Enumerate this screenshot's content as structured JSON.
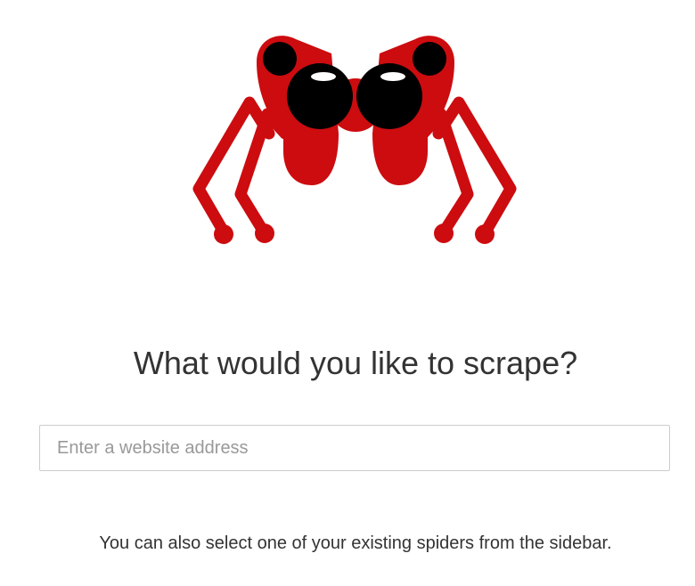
{
  "logo": {
    "icon": "spider-logo-icon",
    "colors": {
      "body": "#cc0c0f",
      "eyes": "#000000",
      "eye_highlight": "#ffffff"
    }
  },
  "main": {
    "heading": "What would you like to scrape?",
    "address_input": {
      "value": "",
      "placeholder": "Enter a website address"
    },
    "hint": "You can also select one of your existing spiders from the sidebar."
  }
}
